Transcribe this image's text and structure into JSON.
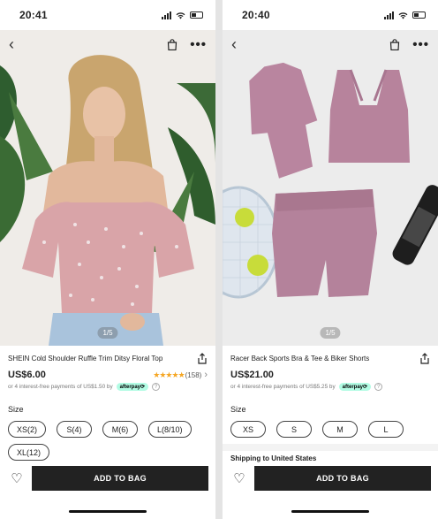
{
  "left": {
    "status": {
      "time": "20:41"
    },
    "pager": "1/5",
    "product": {
      "title": "SHEIN Cold Shoulder Ruffle Trim Ditsy Floral Top",
      "price": "US$6.00",
      "rating_stars": "★★★★★",
      "rating_count": "(158)",
      "afterpay_text": "or 4 interest-free payments of US$1.50 by",
      "afterpay_badge": "afterpay⟳"
    },
    "size_label": "Size",
    "sizes": [
      "XS(2)",
      "S(4)",
      "M(6)",
      "L(8/10)",
      "XL(12)"
    ],
    "add_to_bag": "ADD TO BAG"
  },
  "right": {
    "status": {
      "time": "20:40"
    },
    "pager": "1/5",
    "product": {
      "title": "Racer Back Sports Bra & Tee & Biker Shorts",
      "price": "US$21.00",
      "afterpay_text": "or 4 interest-free payments of US$5.25 by",
      "afterpay_badge": "afterpay⟳"
    },
    "size_label": "Size",
    "sizes": [
      "XS",
      "S",
      "M",
      "L"
    ],
    "shipping_label": "Shipping to United States",
    "add_to_bag": "ADD TO BAG"
  },
  "icons": {
    "back": "‹",
    "bag": "bag-icon",
    "more": "•••",
    "share": "share-icon",
    "heart": "♡",
    "rating_chevron": "›",
    "help": "?"
  },
  "colors": {
    "afterpay_badge_bg": "#b2fce4",
    "star": "#f5a623",
    "button": "#222222"
  }
}
